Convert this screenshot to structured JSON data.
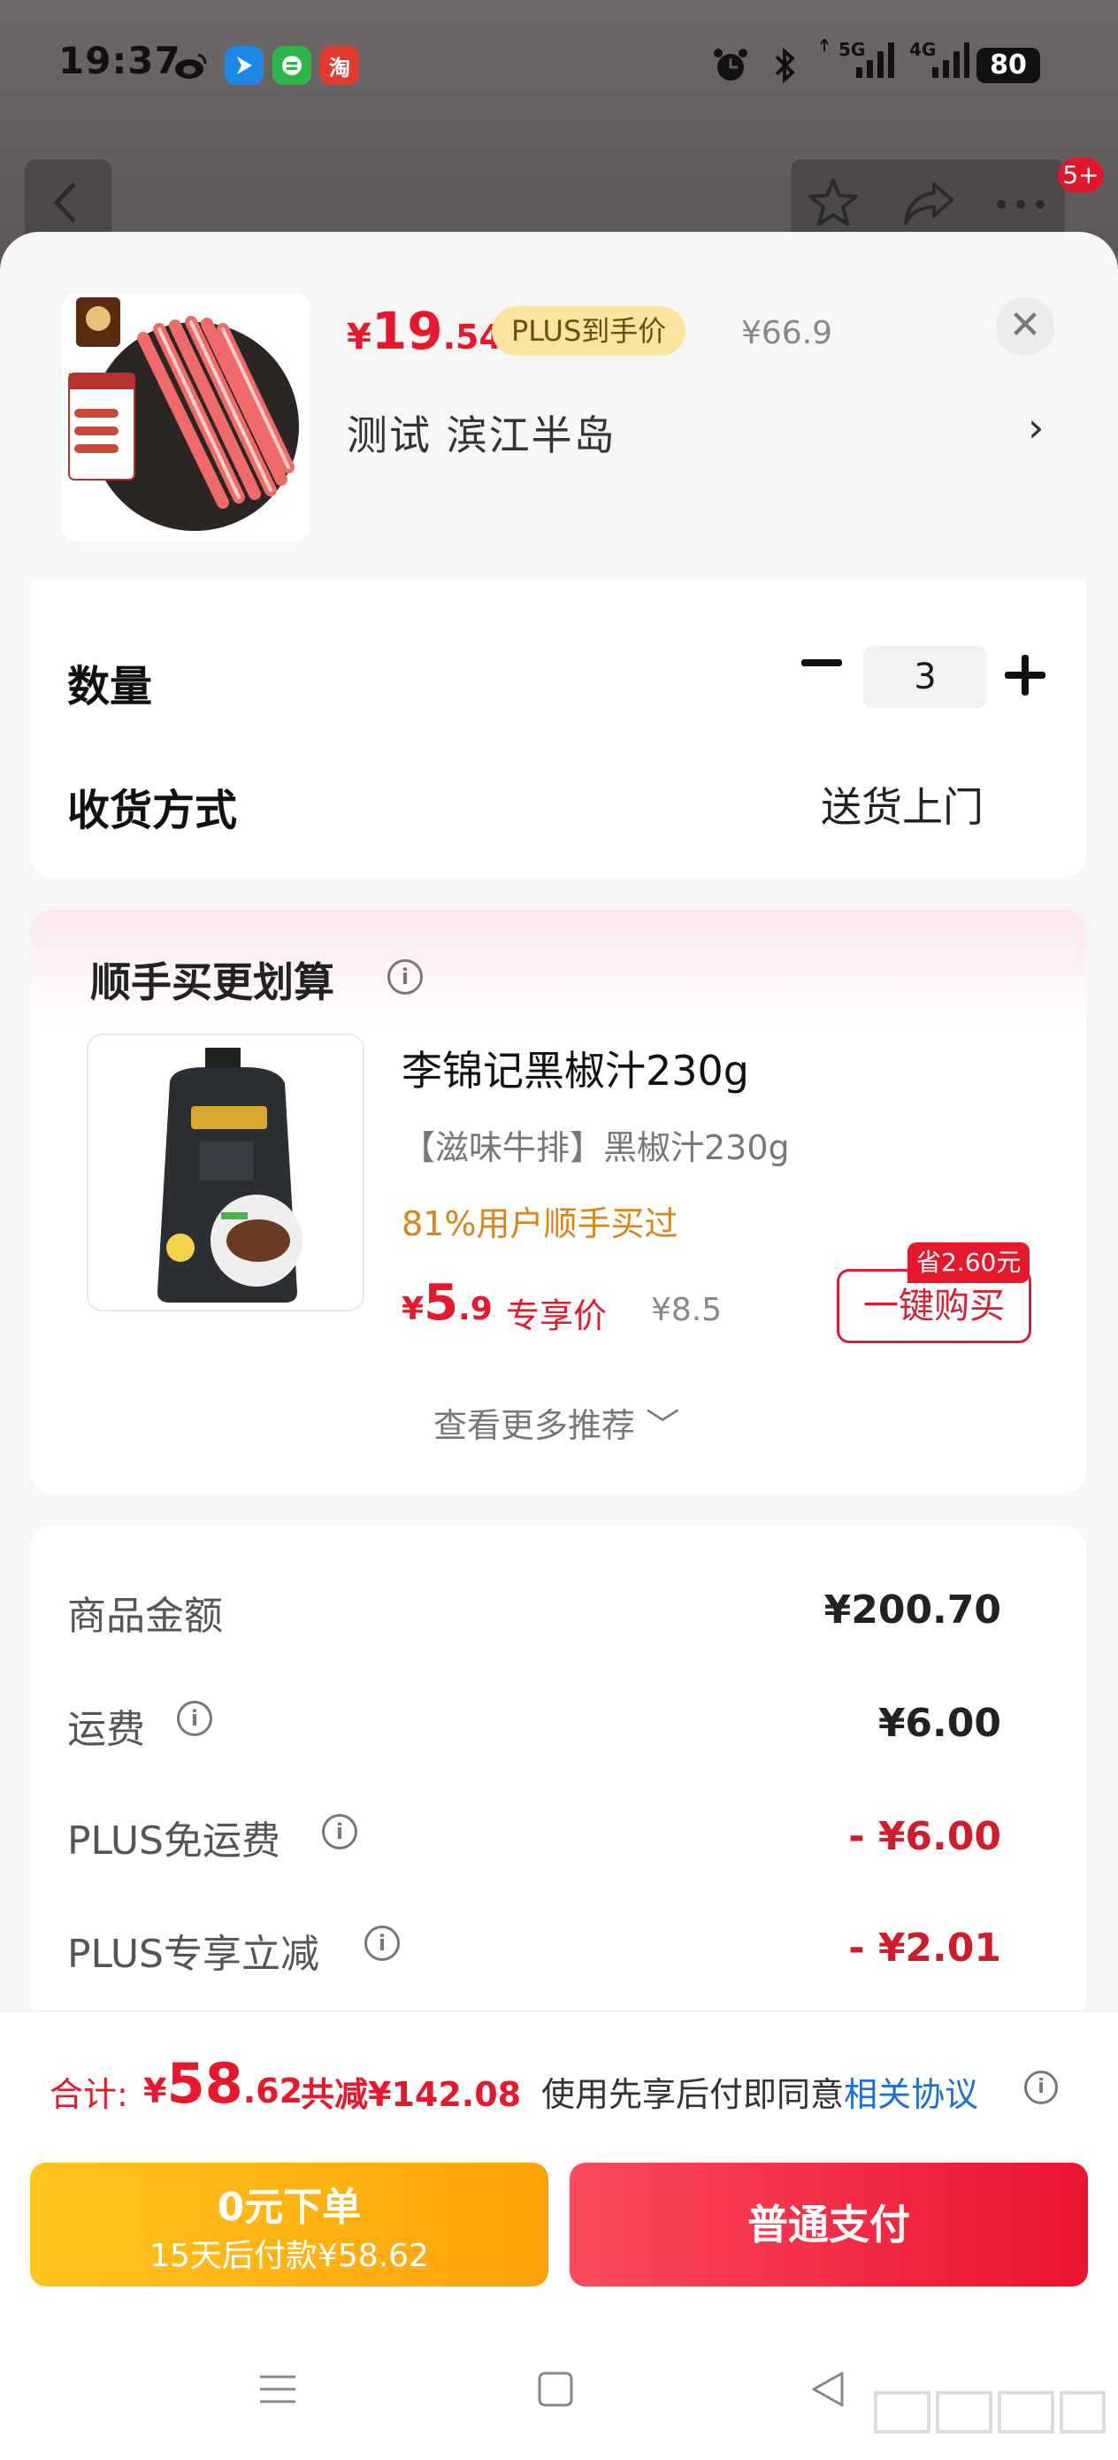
{
  "status": {
    "time": "19:37",
    "network_5g": "5G",
    "network_4g": "4G",
    "battery": "80",
    "app_icons": [
      "weibo-icon",
      "direction-app-icon",
      "message-app-icon",
      "taobao-icon"
    ],
    "taobao_glyph": "淘"
  },
  "background": {
    "notification_count": "5+"
  },
  "product": {
    "price_symbol": "¥",
    "price_integer": "19",
    "price_decimal": ".54",
    "plus_tag": "PLUS到手价",
    "original_price": "¥66.9",
    "address": "测试 滨江半岛",
    "address_chevron": "›",
    "close_glyph": "✕"
  },
  "options": {
    "quantity_label": "数量",
    "quantity_value": "3",
    "delivery_label": "收货方式",
    "delivery_value": "送货上门"
  },
  "recommendation": {
    "title": "顺手买更划算",
    "info_glyph": "i",
    "item_name": "李锦记黑椒汁230g",
    "item_sub": "【滋味牛排】黑椒汁230g",
    "item_buy_rate": "81%用户顺手买过",
    "price_symbol": "¥",
    "price_integer": "5",
    "price_decimal": ".9",
    "exclusive_label": "专享价",
    "original_price": "¥8.5",
    "save_tag": "省2.60元",
    "buy_button": "一键购买",
    "more_link": "查看更多推荐 ﹀"
  },
  "summary": {
    "rows": [
      {
        "label": "商品金额",
        "value": "¥200.70"
      },
      {
        "label": "运费",
        "value": "¥6.00"
      },
      {
        "label": "PLUS免运费",
        "value": "- ¥6.00"
      },
      {
        "label": "PLUS专享立减",
        "value": "- ¥2.01"
      }
    ]
  },
  "footer": {
    "total_label": "合计:",
    "total_symbol": "¥",
    "total_integer": "58",
    "total_decimal": ".62",
    "total_reduce": "共减¥142.08",
    "agree_text": "使用先享后付即同意",
    "agree_link": "相关协议",
    "zero_pay_title": "0元下单",
    "zero_pay_sub": "15天后付款¥58.62",
    "normal_pay": "普通支付"
  },
  "colors": {
    "accent_red": "#e6192c",
    "plus_gold": "#fbe3a0",
    "zero_pay_yellow": "#ffb414",
    "link_blue": "#1f6fd6"
  }
}
